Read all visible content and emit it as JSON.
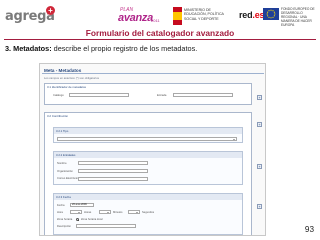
{
  "header": {
    "agrega_logo": "agrega",
    "agrega_plus": "+",
    "avanza_logo": {
      "prefix": "PLAN",
      "main": "avanza",
      "suffix": "2011"
    },
    "ministerio_text": "MINISTERIO DE EDUCACIÓN, POLÍTICA SOCIAL Y DEPORTE",
    "redes_logo": {
      "word": "red",
      "suffix": ".es"
    },
    "eu_text": "FONDO EUROPEO DE DESARROLLO REGIONAL · UNA MANERA DE HACER EUROPA"
  },
  "title": "Formulario del catalogador avanzado",
  "intro": {
    "label": "3. Metadatos:",
    "text": " describe el propio registro de los metadatos."
  },
  "form": {
    "window_title": "Meta - Metadatos",
    "description": "Los campos en asterisco (*) son obligatorios",
    "identifier_section": {
      "title": "3.1 Identificador de metadatos",
      "catalog_label": "Catálogo",
      "entry_label": "Entrada",
      "add_symbol": "+"
    },
    "contributor_section": {
      "title": "3.2 Contribución",
      "type_title": "3.2.1 Tipo",
      "entities_title": "3.2.2 Entidades",
      "entity_fields": [
        "Nombre",
        "Organización",
        "Correo Electrónico"
      ],
      "date_title": "3.2.3 Fecha",
      "date_fields": {
        "date_label": "Fecha",
        "date_value": "20-ene-2009",
        "time_label": "Hora",
        "hours_label": "Horas",
        "minutes_label": "Minutos",
        "seconds_label": "Segundos",
        "zone_label": "Zona horaria",
        "zone_option": "Zona horaria local",
        "description_label": "Descripción"
      }
    }
  },
  "colors": {
    "title": "#a31d3f",
    "form_accent": "#2b4b7f"
  },
  "page_number": "93"
}
